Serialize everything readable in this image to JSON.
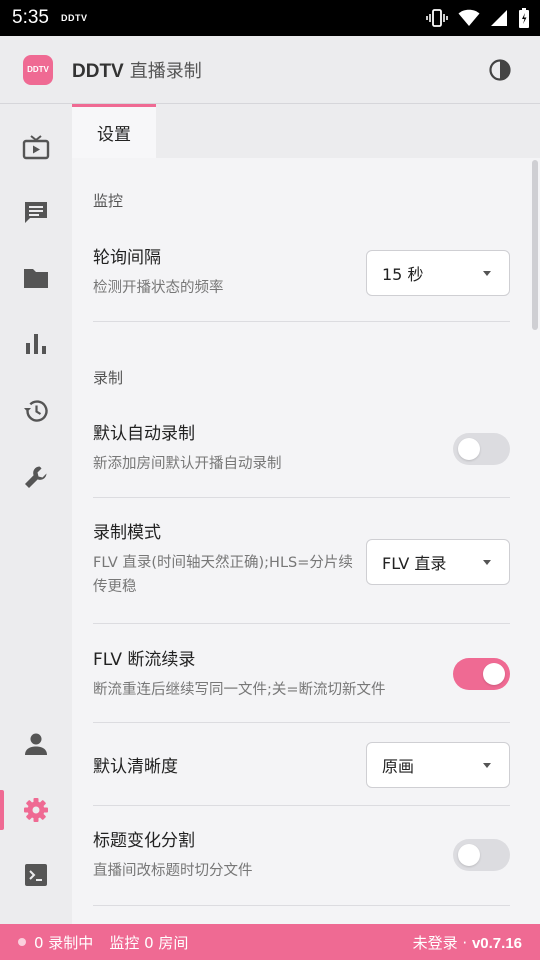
{
  "status_bar": {
    "time": "5:35",
    "app_indicator": "DDTV",
    "icons": [
      "vibrate-icon",
      "wifi-icon",
      "signal-icon",
      "battery-icon"
    ]
  },
  "app_bar": {
    "logo_text": "DDTV",
    "brand": "DDTV",
    "subtitle": "直播录制",
    "theme_icon": "contrast-icon"
  },
  "rail": {
    "items": [
      {
        "icon": "tv-icon"
      },
      {
        "icon": "chat-icon"
      },
      {
        "icon": "folder-icon"
      },
      {
        "icon": "bar-chart-icon"
      },
      {
        "icon": "history-icon"
      },
      {
        "icon": "wrench-icon"
      },
      {
        "icon": "person-icon"
      },
      {
        "icon": "gear-icon"
      },
      {
        "icon": "terminal-icon"
      }
    ],
    "active_icon": "gear-icon"
  },
  "tabs": [
    {
      "label": "设置",
      "active": true
    }
  ],
  "sections": {
    "monitor": {
      "title": "监控"
    },
    "record": {
      "title": "录制"
    }
  },
  "settings": {
    "poll_interval": {
      "title": "轮询间隔",
      "desc": "检测开播状态的频率",
      "value": "15 秒"
    },
    "auto_record": {
      "title": "默认自动录制",
      "desc": "新添加房间默认开播自动录制",
      "enabled": false
    },
    "record_mode": {
      "title": "录制模式",
      "desc": "FLV 直录(时间轴天然正确);HLS=分片续传更稳",
      "value": "FLV 直录"
    },
    "flv_resume": {
      "title": "FLV 断流续录",
      "desc": "断流重连后继续写同一文件;关=断流切新文件",
      "enabled": true
    },
    "default_quality": {
      "title": "默认清晰度",
      "value": "原画"
    },
    "title_split": {
      "title": "标题变化分割",
      "desc": "直播间改标题时切分文件",
      "enabled": false
    }
  },
  "footer": {
    "recording_count": "0 录制中",
    "monitor_count": "监控 0 房间",
    "login_status": "未登录",
    "separator": "·",
    "version": "v0.7.16"
  },
  "colors": {
    "accent": "#ef6a93",
    "background": "#f4f4f6",
    "rail": "#ececee"
  }
}
